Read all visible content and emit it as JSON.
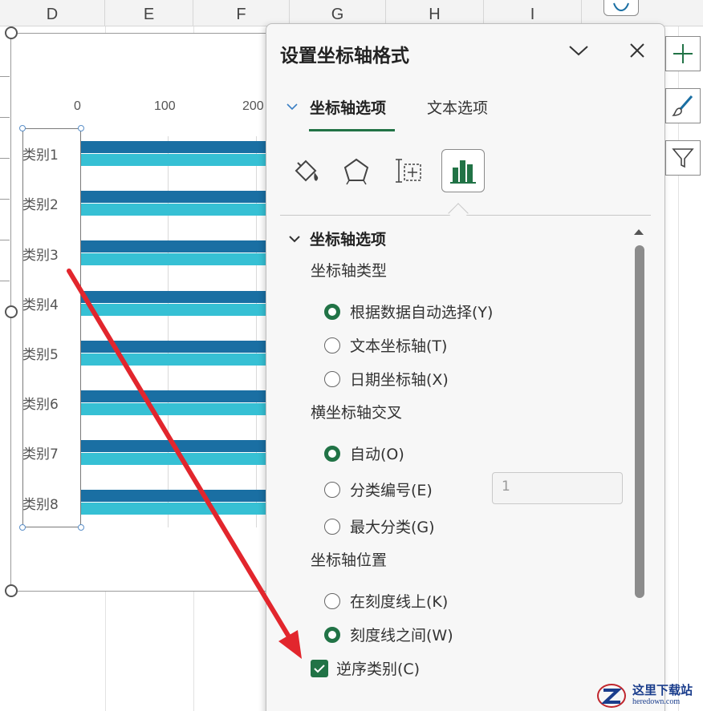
{
  "columns": [
    "D",
    "E",
    "F",
    "G",
    "H",
    "I"
  ],
  "chart": {
    "axis_ticks": [
      "0",
      "100",
      "200"
    ],
    "categories": [
      "类别1",
      "类别2",
      "类别3",
      "类别4",
      "类别5",
      "类别6",
      "类别7",
      "类别8"
    ],
    "series_colors": [
      "#1a6fa3",
      "#36c0d4"
    ]
  },
  "pane": {
    "title": "设置坐标轴格式",
    "tabs": [
      {
        "label": "坐标轴选项",
        "active": true
      },
      {
        "label": "文本选项",
        "active": false
      }
    ],
    "icons": [
      "fill-line-icon",
      "effects-pentagon-icon",
      "size-properties-icon",
      "axis-options-bar-chart-icon"
    ],
    "section": {
      "title": "坐标轴选项",
      "axis_type": {
        "label": "坐标轴类型",
        "options": [
          {
            "label": "根据数据自动选择(Y)",
            "selected": true
          },
          {
            "label": "文本坐标轴(T)",
            "selected": false
          },
          {
            "label": "日期坐标轴(X)",
            "selected": false
          }
        ]
      },
      "crosses": {
        "label": "横坐标轴交叉",
        "options": [
          {
            "label": "自动(O)",
            "selected": true
          },
          {
            "label": "分类编号(E)",
            "selected": false
          },
          {
            "label": "最大分类(G)",
            "selected": false
          }
        ],
        "category_number_value": "1"
      },
      "position": {
        "label": "坐标轴位置",
        "options": [
          {
            "label": "在刻度线上(K)",
            "selected": false
          },
          {
            "label": "刻度线之间(W)",
            "selected": true
          }
        ]
      },
      "reverse_order": {
        "label": "逆序类别(C)",
        "checked": true
      }
    }
  },
  "accent": "#217346",
  "annotation_arrow_color": "#e2262d",
  "watermark": {
    "cn": "这里下载站",
    "en": "heredown.com"
  }
}
